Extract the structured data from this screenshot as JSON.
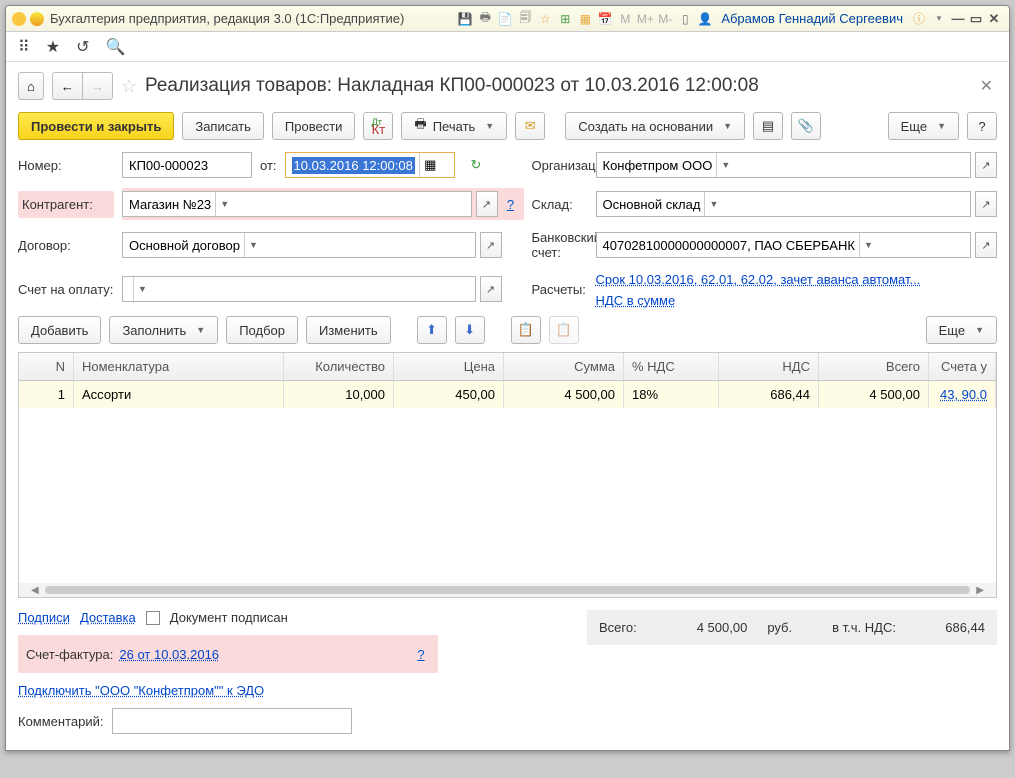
{
  "titlebar": {
    "app": "Бухгалтерия предприятия, редакция 3.0  (1С:Предприятие)",
    "user": "Абрамов Геннадий Сергеевич"
  },
  "header": {
    "title": "Реализация товаров: Накладная КП00-000023 от 10.03.2016 12:00:08"
  },
  "cmd": {
    "post_close": "Провести и закрыть",
    "write": "Записать",
    "post": "Провести",
    "print": "Печать",
    "base": "Создать на основании",
    "more": "Еще"
  },
  "form": {
    "number_l": "Номер:",
    "number": "КП00-000023",
    "from_l": "от:",
    "date": "10.03.2016 12:00:08",
    "org_l": "Организация:",
    "org": "Конфетпром ООО",
    "partner_l": "Контрагент:",
    "partner": "Магазин №23",
    "wh_l": "Склад:",
    "wh": "Основной склад",
    "contract_l": "Договор:",
    "contract": "Основной договор",
    "bank_l": "Банковский счет:",
    "bank": "40702810000000000007, ПАО СБЕРБАНК",
    "invoice_l": "Счет на оплату:",
    "invoice_ph": "",
    "calc_l": "Расчеты:",
    "calc_link": "Срок 10.03.2016, 62.01, 62.02, зачет аванса автомат...",
    "vat_link": "НДС в сумме"
  },
  "tbl_cmd": {
    "add": "Добавить",
    "fill": "Заполнить",
    "pick": "Подбор",
    "edit": "Изменить",
    "more": "Еще"
  },
  "cols": {
    "n": "N",
    "nom": "Номенклатура",
    "qty": "Количество",
    "price": "Цена",
    "sum": "Сумма",
    "vatp": "% НДС",
    "vat": "НДС",
    "tot": "Всего",
    "acc": "Счета у"
  },
  "rows": [
    {
      "n": "1",
      "nom": "Ассорти",
      "qty": "10,000",
      "price": "450,00",
      "sum": "4 500,00",
      "vatp": "18%",
      "vat": "686,44",
      "tot": "4 500,00",
      "acc": "43, 90.0"
    }
  ],
  "footer": {
    "sign": "Подписи",
    "delivery": "Доставка",
    "signed": "Документ подписан",
    "total_l": "Всего:",
    "total": "4 500,00",
    "rub": "руб.",
    "vat_l": "в т.ч. НДС:",
    "vat": "686,44",
    "sf_l": "Счет-фактура:",
    "sf": "26 от 10.03.2016",
    "edo": "Подключить \"ООО \"Конфетпром\"\" к ЭДО",
    "comment_l": "Комментарий:"
  }
}
